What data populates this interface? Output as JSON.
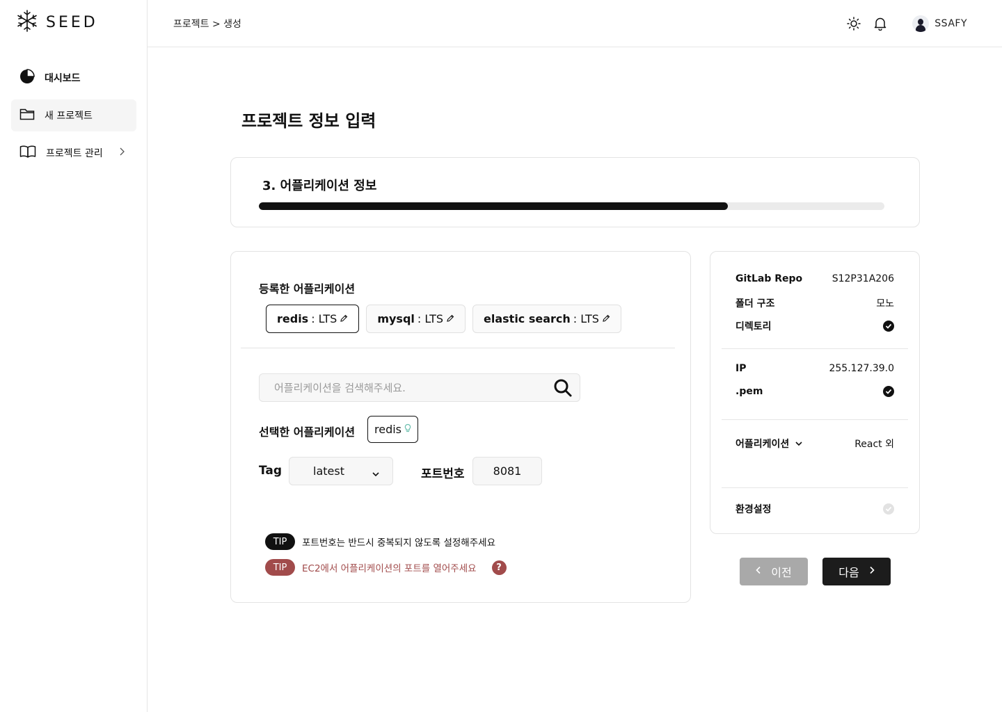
{
  "app": {
    "logo_text": "SEED"
  },
  "sidebar": {
    "items": [
      {
        "label": "대시보드",
        "icon": "pie-chart-icon"
      },
      {
        "label": "새 프로젝트",
        "icon": "folder-icon"
      },
      {
        "label": "프로젝트 관리",
        "icon": "book-icon"
      }
    ]
  },
  "header": {
    "breadcrumb": "프로젝트 > 생성",
    "username": "SSAFY"
  },
  "page": {
    "title": "프로젝트 정보 입력"
  },
  "step": {
    "title": "3. 어플리케이션 정보",
    "progress": 0.75
  },
  "form": {
    "registered_label": "등록한 어플리케이션",
    "registered_apps": [
      {
        "name": "redis",
        "version": " : LTS"
      },
      {
        "name": "mysql",
        "version": " : LTS"
      },
      {
        "name": "elastic search",
        "version": " : LTS"
      }
    ],
    "search_placeholder": "어플리케이션을 검색해주세요.",
    "selected_label": "선택한 어플리케이션",
    "selected_app": "redis",
    "tag_label": "Tag",
    "tag_value": "latest",
    "port_label": "포트번호",
    "port_value": "8081",
    "tips": [
      {
        "badge": "TIP",
        "text": "포트번호는 반드시 중복되지 않도록 설정해주세요"
      },
      {
        "badge": "TIP",
        "text": "EC2에서 어플리케이션의 포트를 열어주세요"
      }
    ],
    "help_glyph": "?"
  },
  "summary": {
    "gitlab_repo_label": "GitLab Repo",
    "gitlab_repo_value": "S12P31A206",
    "folder_label": "폴더 구조",
    "folder_value": "모노",
    "directory_label": "디렉토리",
    "ip_label": "IP",
    "ip_value": "255.127.39.0",
    "pem_label": ".pem",
    "apps_label": "어플리케이션",
    "apps_value": "React 외",
    "env_label": "환경설정"
  },
  "nav": {
    "prev_label": "이전",
    "next_label": "다음"
  },
  "colors": {
    "accent": "#111111",
    "warn": "#a14b4b",
    "disabled": "#a9a9a9"
  }
}
